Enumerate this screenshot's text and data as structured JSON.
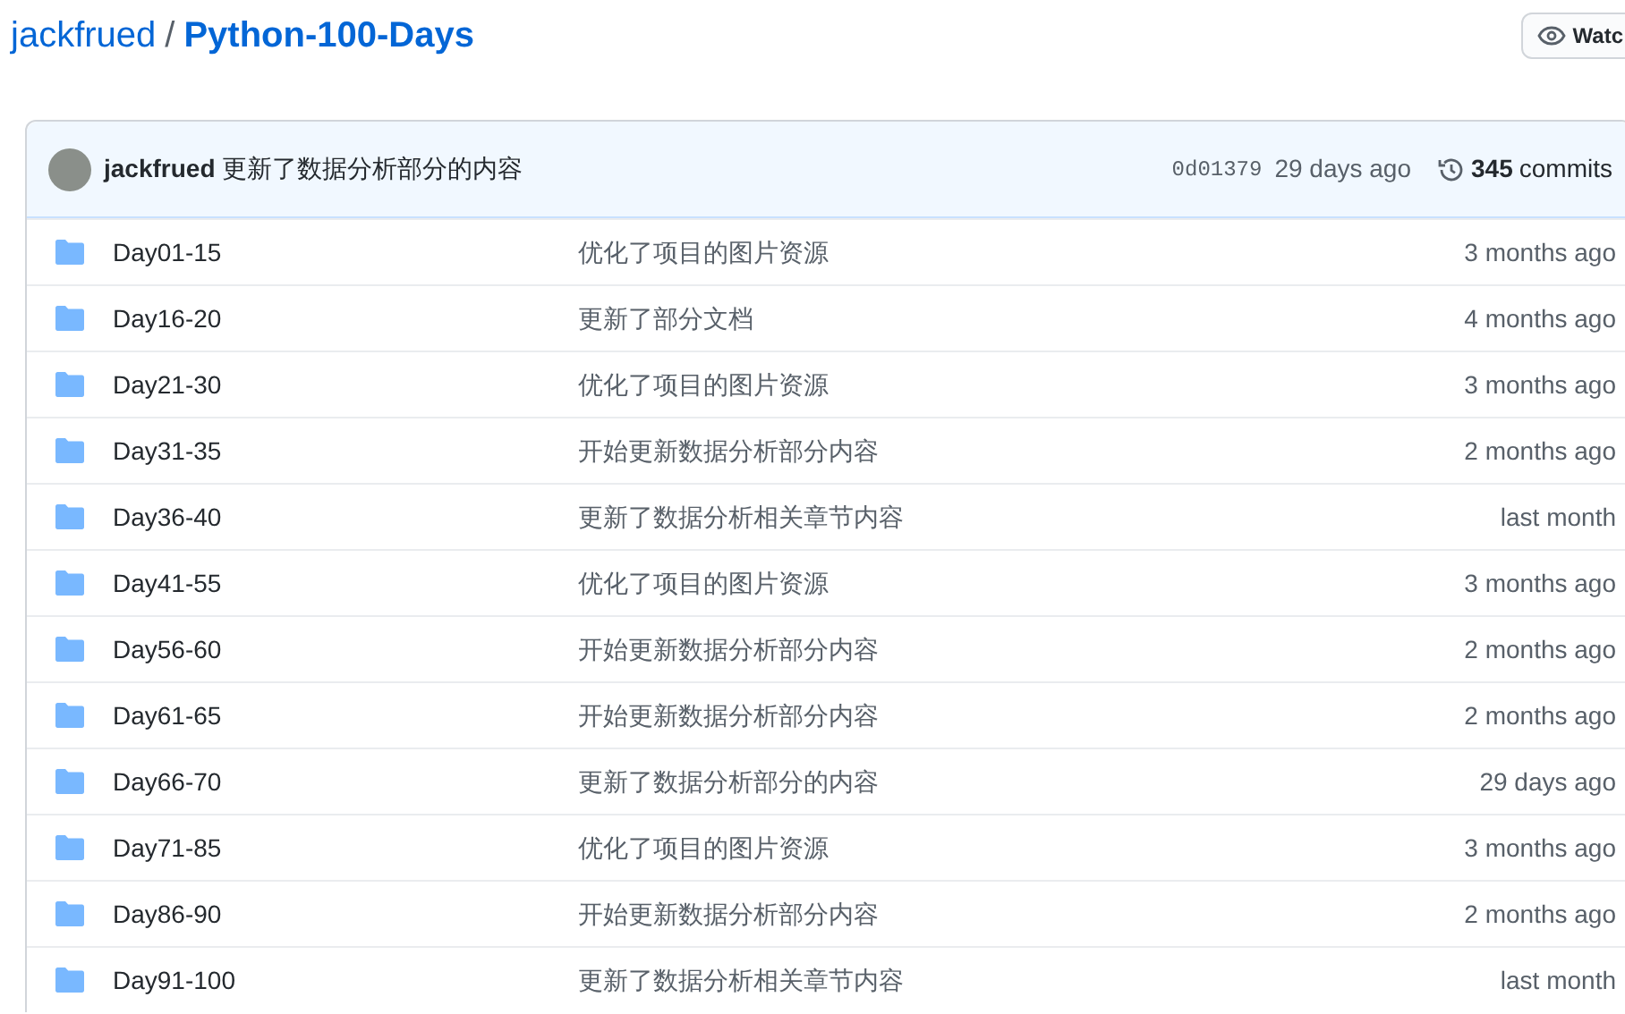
{
  "repo": {
    "owner": "jackfrued",
    "separator": "/",
    "name": "Python-100-Days",
    "watch_button": "Watc"
  },
  "latest_commit": {
    "author": "jackfrued",
    "message": "更新了数据分析部分的内容",
    "sha": "0d01379",
    "age": "29 days ago",
    "commit_count": "345",
    "commit_label": "commits"
  },
  "files": [
    {
      "name": "Day01-15",
      "message": "优化了项目的图片资源",
      "age": "3 months ago"
    },
    {
      "name": "Day16-20",
      "message": "更新了部分文档",
      "age": "4 months ago"
    },
    {
      "name": "Day21-30",
      "message": "优化了项目的图片资源",
      "age": "3 months ago"
    },
    {
      "name": "Day31-35",
      "message": "开始更新数据分析部分内容",
      "age": "2 months ago"
    },
    {
      "name": "Day36-40",
      "message": "更新了数据分析相关章节内容",
      "age": "last month"
    },
    {
      "name": "Day41-55",
      "message": "优化了项目的图片资源",
      "age": "3 months ago"
    },
    {
      "name": "Day56-60",
      "message": "开始更新数据分析部分内容",
      "age": "2 months ago"
    },
    {
      "name": "Day61-65",
      "message": "开始更新数据分析部分内容",
      "age": "2 months ago"
    },
    {
      "name": "Day66-70",
      "message": "更新了数据分析部分的内容",
      "age": "29 days ago"
    },
    {
      "name": "Day71-85",
      "message": "优化了项目的图片资源",
      "age": "3 months ago"
    },
    {
      "name": "Day86-90",
      "message": "开始更新数据分析部分内容",
      "age": "2 months ago"
    },
    {
      "name": "Day91-100",
      "message": "更新了数据分析相关章节内容",
      "age": "last month"
    }
  ]
}
